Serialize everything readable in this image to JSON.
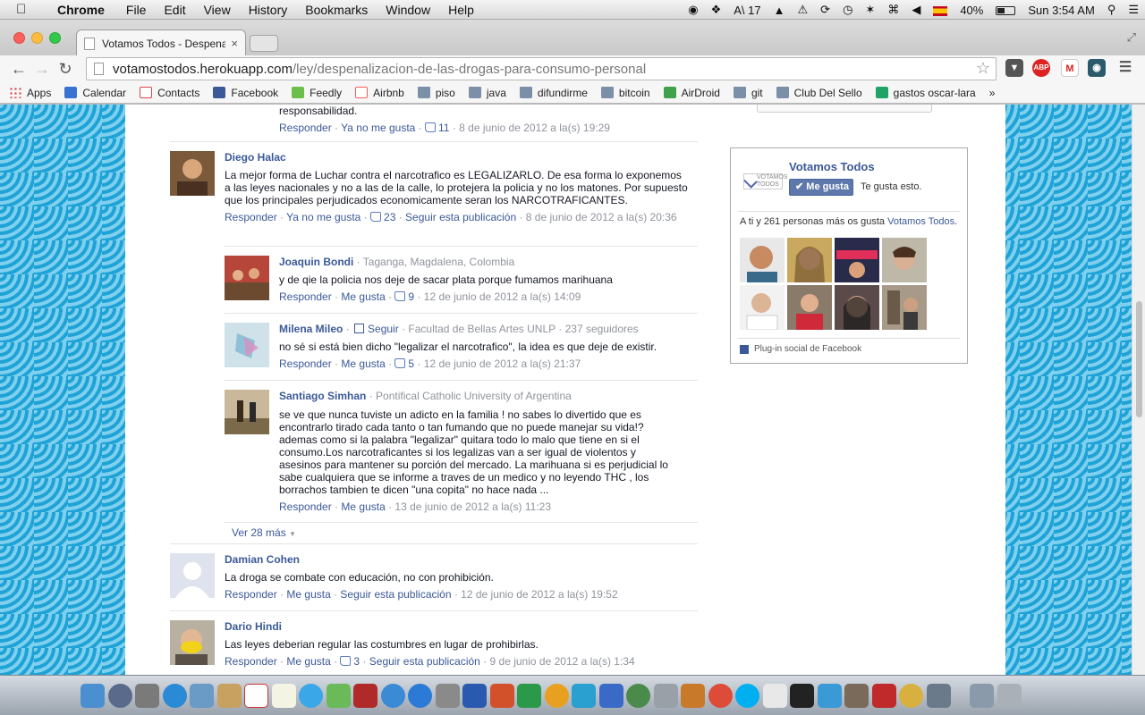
{
  "menubar": {
    "app": "Chrome",
    "menus": [
      "File",
      "Edit",
      "View",
      "History",
      "Bookmarks",
      "Window",
      "Help"
    ],
    "status_notifications": "17",
    "battery": "40%",
    "clock": "Sun 3:54 AM"
  },
  "browser": {
    "tab_title": "Votamos Todos - Despena",
    "url_host": "votamostodos.herokuapp.com",
    "url_path": "/ley/despenalizacion-de-las-drogas-para-consumo-personal",
    "extensions": [
      "ABP"
    ],
    "bookmarks": [
      "Apps",
      "Calendar",
      "Contacts",
      "Facebook",
      "Feedly",
      "Airbnb",
      "piso",
      "java",
      "difundirme",
      "bitcoin",
      "AirDroid",
      "git",
      "Club Del Sello",
      "gastos oscar-lara"
    ]
  },
  "comments": {
    "top_fragment": {
      "text": "responsabilidad.",
      "reply": "Responder",
      "like_action": "Ya no me gusta",
      "likes": "11",
      "date": "8 de junio de 2012 a la(s) 19:29"
    },
    "c1": {
      "author": "Diego Halac",
      "text": "La mejor forma de Luchar contra el narcotrafico es LEGALIZARLO. De esa forma lo exponemos a las leyes nacionales y no a las de la calle, lo protejera la policia y no los matones. Por supuesto que los principales perjudicados economicamente seran los NARCOTRAFICANTES.",
      "reply": "Responder",
      "like_action": "Ya no me gusta",
      "likes": "23",
      "follow": "Seguir esta publicación",
      "date": "8 de junio de 2012 a la(s) 20:36"
    },
    "r1": {
      "author": "Joaquin Bondi",
      "info": "Taganga, Magdalena, Colombia",
      "text": "y de qie la policia nos deje de sacar plata porque fumamos marihuana",
      "reply": "Responder",
      "like_action": "Me gusta",
      "likes": "9",
      "date": "12 de junio de 2012 a la(s) 14:09"
    },
    "r2": {
      "author": "Milena Mileo",
      "follow": "Seguir",
      "info": "Facultad de Bellas Artes UNLP · 237 seguidores",
      "text": "no sé si está bien dicho \"legalizar el narcotrafico\", la idea es que deje de existir.",
      "reply": "Responder",
      "like_action": "Me gusta",
      "likes": "5",
      "date": "12 de junio de 2012 a la(s) 21:37"
    },
    "r3": {
      "author": "Santiago Simhan",
      "info": "Pontifical Catholic University of Argentina",
      "text": "se ve que nunca tuviste un adicto en la familia ! no sabes lo divertido que es encontrarlo tirado cada tanto o tan fumando que no puede manejar su vida!? ademas como si la palabra \"legalizar\" quitara todo lo malo que tiene en si el consumo.Los narcotraficantes si los legalizas van a ser igual de violentos y asesinos para mantener su porción del mercado. La marihuana si es perjudicial lo sabe cualquiera que se informe a traves de un medico y no leyendo THC , los borrachos tambien te dicen \"una copita\" no hace nada ...",
      "reply": "Responder",
      "like_action": "Me gusta",
      "date": "13 de junio de 2012 a la(s) 11:23"
    },
    "more": "Ver 28 más",
    "c2": {
      "author": "Damian Cohen",
      "text": "La droga se combate con educación, no con prohibición.",
      "reply": "Responder",
      "like_action": "Me gusta",
      "follow": "Seguir esta publicación",
      "date": "12 de junio de 2012 a la(s) 19:52"
    },
    "c3": {
      "author": "Dario Hindi",
      "text": "Las leyes deberian regular las costumbres en lugar de prohibirlas.",
      "reply": "Responder",
      "like_action": "Me gusta",
      "likes": "3",
      "follow": "Seguir esta publicación",
      "date": "9 de junio de 2012 a la(s) 1:34"
    }
  },
  "likebox": {
    "page_name": "Votamos Todos",
    "logo_text": "VOTAMOS TODOS",
    "like_button": "Me gusta",
    "like_status": "Te gusta esto.",
    "count_prefix": "A ti y 261 personas más os gusta ",
    "count_link": "Votamos Todos",
    "count_suffix": ".",
    "plugin": "Plug-in social de Facebook"
  },
  "colors": {
    "facebook_blue": "#3b5998",
    "background_pattern": "#1fa3d6",
    "meta_grey": "#90949c"
  }
}
